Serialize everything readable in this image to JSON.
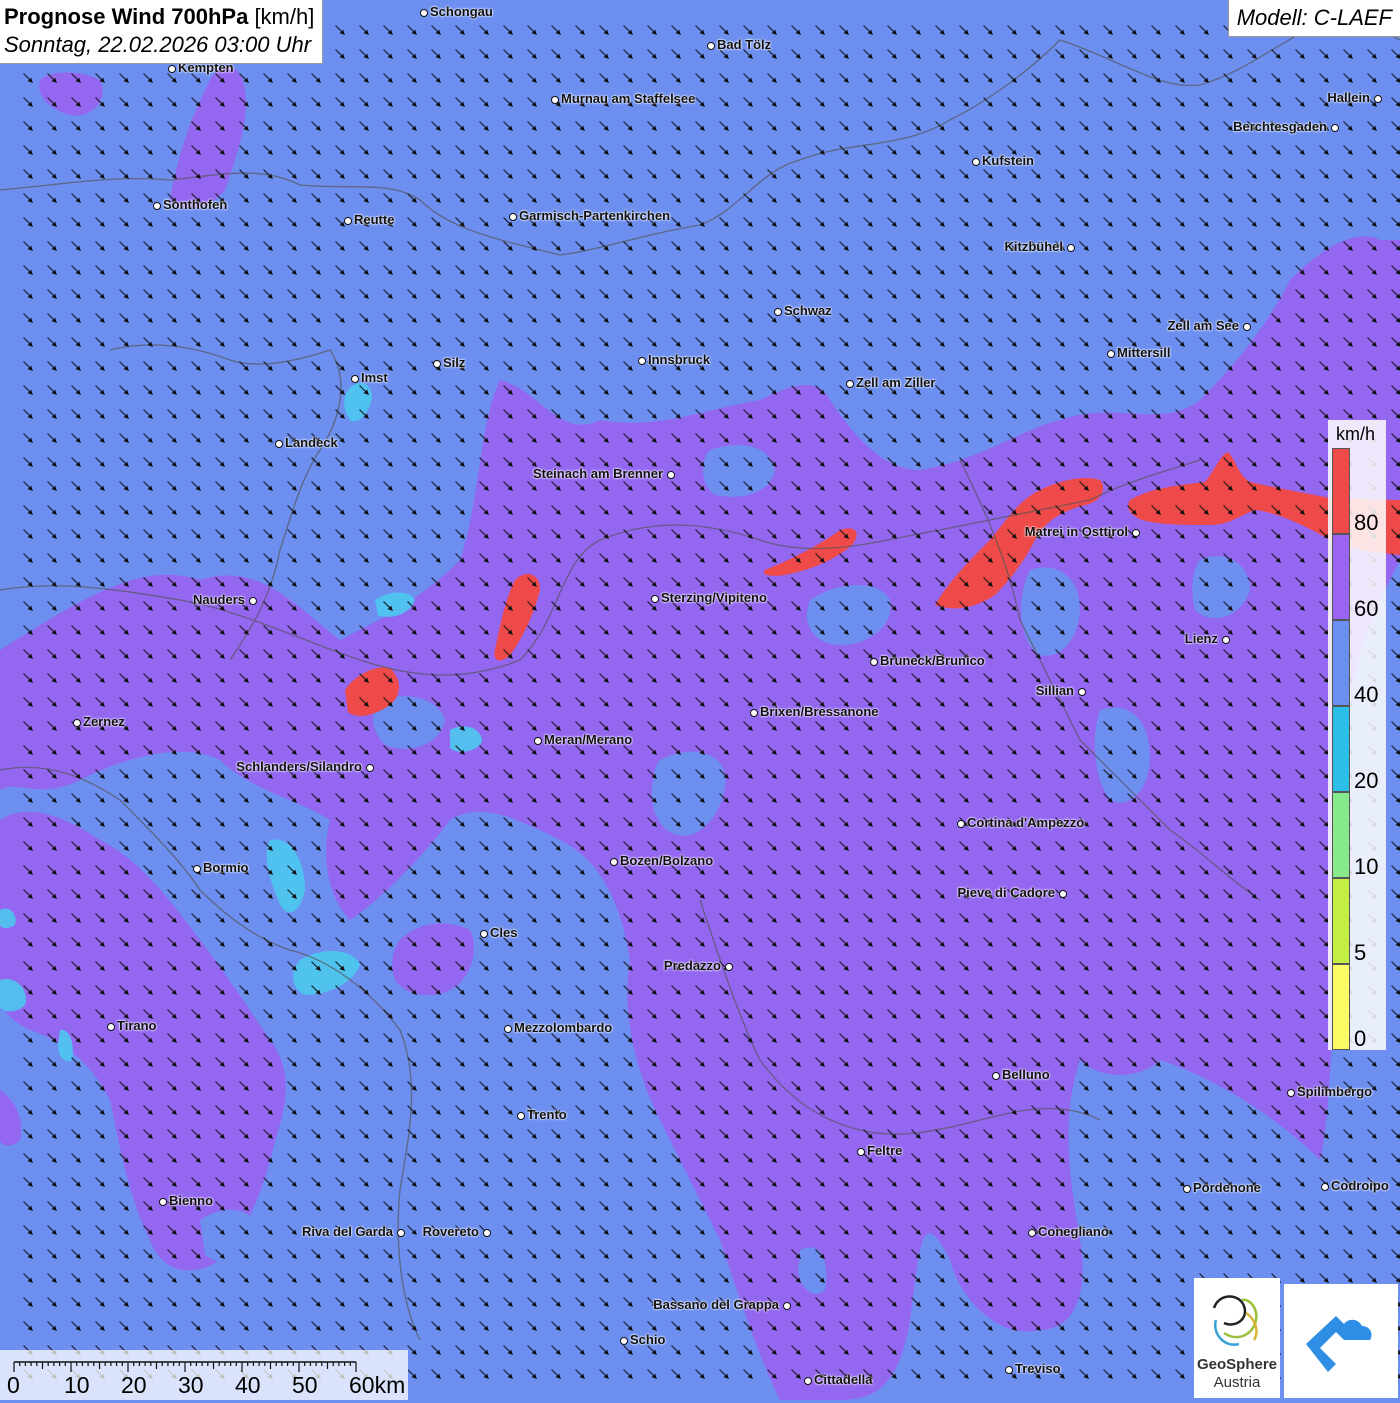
{
  "title": {
    "main": "Prognose Wind 700hPa",
    "unit": "[km/h]",
    "datetime": "Sonntag, 22.02.2026 03:00 Uhr"
  },
  "model": "Modell: C-LAEF",
  "legend": {
    "unit": "km/h",
    "ticks": [
      "80",
      "60",
      "40",
      "20",
      "10",
      "5",
      "0"
    ],
    "colors": [
      "#ef4a4a",
      "#9b63f2",
      "#6b8ff0",
      "#2bbfe8",
      "#86ea8c",
      "#c3ef45",
      "#fbfb66"
    ]
  },
  "scale_bar": {
    "labels": [
      "0",
      "10",
      "20",
      "30",
      "40",
      "50",
      "60km"
    ]
  },
  "cities": [
    {
      "name": "Schongau"
    },
    {
      "name": "Bad Tölz"
    },
    {
      "name": "Kempten"
    },
    {
      "name": "Murnau am Staffelsee"
    },
    {
      "name": "Hallein"
    },
    {
      "name": "Berchtesgaden"
    },
    {
      "name": "Kufstein"
    },
    {
      "name": "Sonthofen"
    },
    {
      "name": "Reutte"
    },
    {
      "name": "Garmisch-Partenkirchen"
    },
    {
      "name": "Kitzbühel"
    },
    {
      "name": "Schwaz"
    },
    {
      "name": "Zell am See"
    },
    {
      "name": "Mittersill"
    },
    {
      "name": "Silz"
    },
    {
      "name": "Innsbruck"
    },
    {
      "name": "Imst"
    },
    {
      "name": "Zell am Ziller"
    },
    {
      "name": "Landeck"
    },
    {
      "name": "Steinach am Brenner"
    },
    {
      "name": "Matrei in Osttirol"
    },
    {
      "name": "Nauders"
    },
    {
      "name": "Sterzing/Vipiteno"
    },
    {
      "name": "Lienz"
    },
    {
      "name": "Bruneck/Brunico"
    },
    {
      "name": "Sillian"
    },
    {
      "name": "Zernez"
    },
    {
      "name": "Brixen/Bressanone"
    },
    {
      "name": "Meran/Merano"
    },
    {
      "name": "Schlanders/Silandro"
    },
    {
      "name": "Cortina d'Ampezzo"
    },
    {
      "name": "Bormio"
    },
    {
      "name": "Bozen/Bolzano"
    },
    {
      "name": "Pieve di Cadore"
    },
    {
      "name": "Cles"
    },
    {
      "name": "Predazzo"
    },
    {
      "name": "Tirano"
    },
    {
      "name": "Mezzolombardo"
    },
    {
      "name": "Belluno"
    },
    {
      "name": "Spilimbergo"
    },
    {
      "name": "Trento"
    },
    {
      "name": "Feltre"
    },
    {
      "name": "Pordenone"
    },
    {
      "name": "Codroipo"
    },
    {
      "name": "Bienno"
    },
    {
      "name": "Riva del Garda"
    },
    {
      "name": "Rovereto"
    },
    {
      "name": "Conegliano"
    },
    {
      "name": "Bassano del Grappa"
    },
    {
      "name": "Schio"
    },
    {
      "name": "Treviso"
    },
    {
      "name": "Cittadella"
    }
  ],
  "logos": {
    "geosphere_name": "GeoSphere",
    "geosphere_sub": "Austria"
  }
}
